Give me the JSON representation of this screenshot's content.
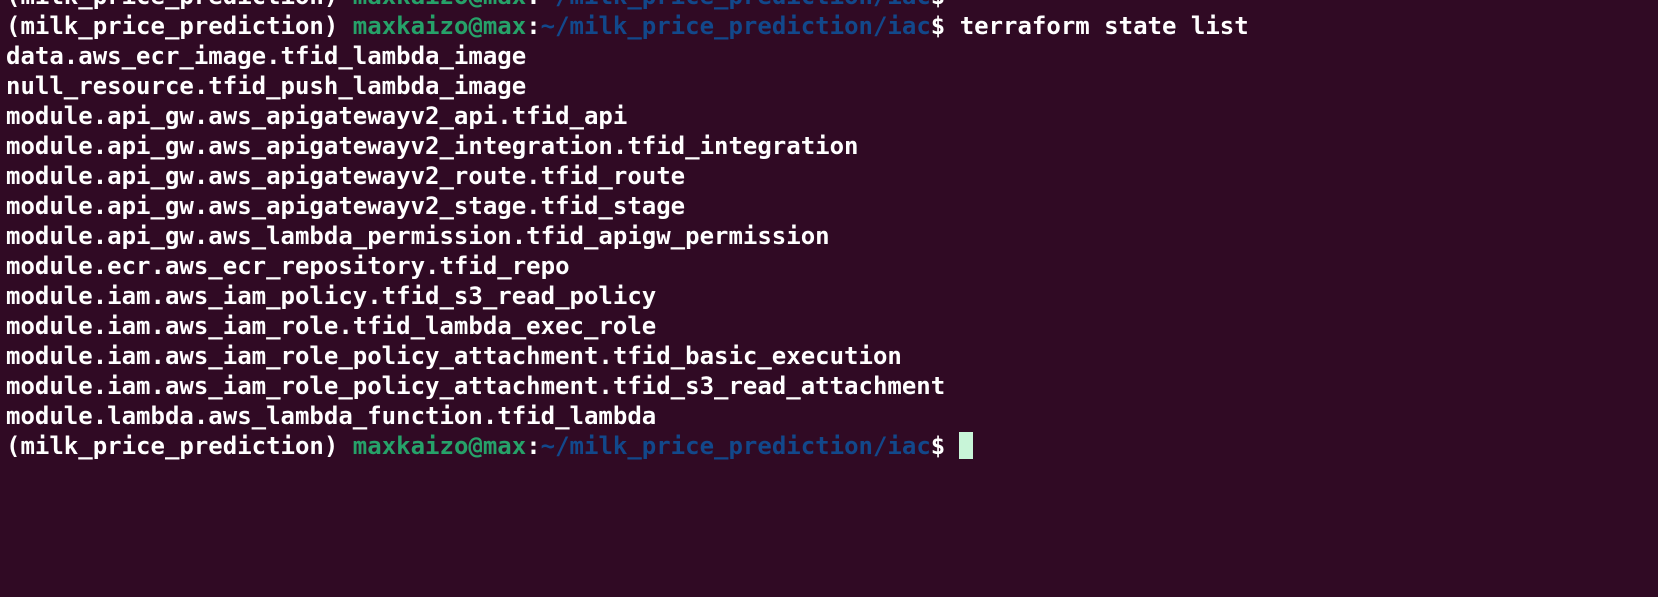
{
  "terminal": {
    "prompt": {
      "env": "(milk_price_prediction)",
      "user_host": "maxkaizo@max",
      "colon": ":",
      "path": "~/milk_price_prediction/iac",
      "dollar": "$"
    },
    "command": "terraform state list",
    "output": [
      "data.aws_ecr_image.tfid_lambda_image",
      "null_resource.tfid_push_lambda_image",
      "module.api_gw.aws_apigatewayv2_api.tfid_api",
      "module.api_gw.aws_apigatewayv2_integration.tfid_integration",
      "module.api_gw.aws_apigatewayv2_route.tfid_route",
      "module.api_gw.aws_apigatewayv2_stage.tfid_stage",
      "module.api_gw.aws_lambda_permission.tfid_apigw_permission",
      "module.ecr.aws_ecr_repository.tfid_repo",
      "module.iam.aws_iam_policy.tfid_s3_read_policy",
      "module.iam.aws_iam_role.tfid_lambda_exec_role",
      "module.iam.aws_iam_role_policy_attachment.tfid_basic_execution",
      "module.iam.aws_iam_role_policy_attachment.tfid_s3_read_attachment",
      "module.lambda.aws_lambda_function.tfid_lambda"
    ],
    "colors": {
      "background": "#300a24",
      "text": "#ffffff",
      "user_host": "#26a269",
      "path": "#12488b",
      "cursor": "#c8f5d8"
    }
  }
}
